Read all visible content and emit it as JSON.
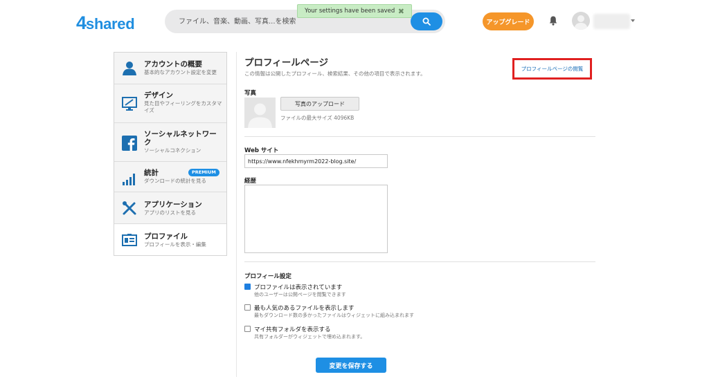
{
  "header": {
    "logo_num": "4",
    "logo_word": "shared",
    "search_placeholder": "ファイル、音楽、動画、写真...を検索",
    "toast": "Your settings have been saved",
    "upgrade_label": "アップグレード"
  },
  "sidebar": {
    "items": [
      {
        "title": "アカウントの概要",
        "sub": "基本的なアカウント設定を変更",
        "icon": "user-icon"
      },
      {
        "title": "デザイン",
        "sub": "見た目やフィーリングをカスタマイズ",
        "icon": "design-monitor-icon"
      },
      {
        "title": "ソーシャルネットワーク",
        "sub": "ソーシャルコネクション",
        "icon": "facebook-icon"
      },
      {
        "title": "統計",
        "sub": "ダウンロードの統計を見る",
        "icon": "stats-bars-icon",
        "badge": "PREMIUM"
      },
      {
        "title": "アプリケーション",
        "sub": "アプリのリストを見る",
        "icon": "tools-icon"
      },
      {
        "title": "プロファイル",
        "sub": "プロフィールを表示・編集",
        "icon": "profile-card-icon"
      }
    ]
  },
  "main": {
    "title": "プロフィールページ",
    "description": "この情報は公開したプロフィール、検索結果、その他の項目で表示されます。",
    "view_link": "プロフィールページの閲覧",
    "photo_label": "写真",
    "upload_button": "写真のアップロード",
    "file_hint": "ファイルの最大サイズ 4096KB",
    "website_label": "Web サイト",
    "website_value": "https://www.nfekhmyrm2022-blog.site/",
    "bio_label": "経歴",
    "bio_value": "",
    "settings_label": "プロフィール設定",
    "settings": [
      {
        "title": "プロファイルは表示されています",
        "sub": "他のユーザーは公開ページを閲覧できます",
        "checked": true
      },
      {
        "title": "最も人気のあるファイルを表示します",
        "sub": "最もダウンロード数の多かったファイルはウィジェットに組み込まれます",
        "checked": false
      },
      {
        "title": "マイ共有フォルダを表示する",
        "sub": "共有フォルダーがウィジェットで埋め込まれます。",
        "checked": false
      }
    ],
    "save_button": "変更を保存する"
  },
  "colors": {
    "brand_blue": "#1e8fe4",
    "upgrade_orange": "#f5962a",
    "toast_green": "#c8ecc4",
    "highlight_red": "#e02020"
  }
}
